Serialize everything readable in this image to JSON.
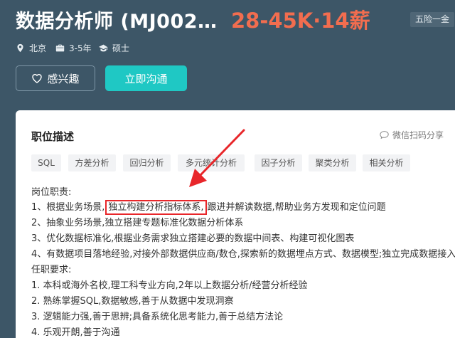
{
  "header": {
    "title": "数据分析师 (MJ002…",
    "salary": "28-45K·14薪",
    "badge": "五险一金",
    "location": "北京",
    "experience": "3-5年",
    "education": "硕士",
    "interest_button": "感兴趣",
    "chat_button": "立即沟通"
  },
  "card": {
    "title": "职位描述",
    "share": "微信扫码分享",
    "tags": [
      "SQL",
      "方差分析",
      "回归分析",
      "多元统计分析",
      "因子分析",
      "聚类分析",
      "相关分析"
    ],
    "section1": "岗位职责:",
    "line1_pre": "1、根据业务场景,",
    "line1_hl": "独立构建分析指标体系,",
    "line1_post": "跟进并解读数据,帮助业务方发现和定位问题",
    "line2": "2、抽象业务场景,独立搭建专题标准化数据分析体系",
    "line3": "3、优化数据标准化,根据业务需求独立搭建必要的数据中间表、构建可视化图表",
    "line4": "4、有数据项目落地经验,对接外部数据供应商/数仓,探索新的数据埋点方式、数据模型;独立完成数据接入工作",
    "section2": "任职要求:",
    "req1": "1. 本科或海外名校,理工科专业方向,2年以上数据分析/经营分析经验",
    "req2": "2. 熟练掌握SQL,数据敏感,善于从数据中发现洞察",
    "req3": "3. 逻辑能力强,善于思辨;具备系统化思考能力,善于总结方法论",
    "req4": "4. 乐观开朗,善于沟通"
  },
  "colors": {
    "header_bg": "#3d5667",
    "salary": "#f26d4f",
    "accent": "#1fc8c4",
    "highlight": "#e8262a"
  }
}
